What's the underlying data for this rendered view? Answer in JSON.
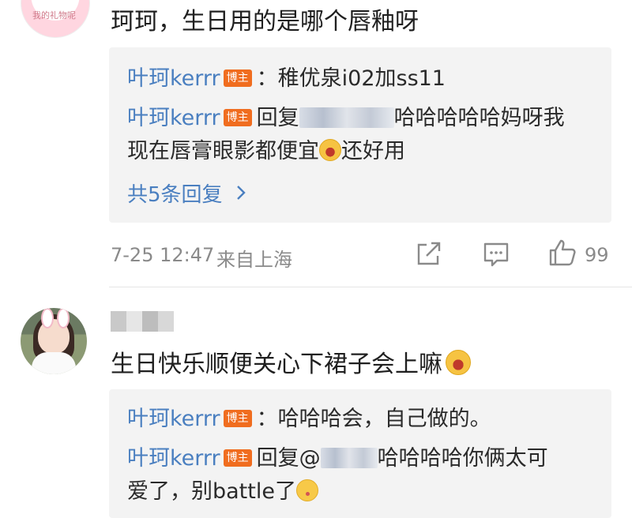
{
  "comment1": {
    "text": "珂珂，生日用的是哪个唇釉呀",
    "avatar_caption": "我的礼物呢",
    "replies": [
      {
        "user": "叶珂kerrr",
        "badge": "博主",
        "text": "：稚优泉i02加ss11"
      },
      {
        "user": "叶珂kerrr",
        "badge": "博主",
        "prefix": "回复",
        "text_a": "哈哈哈哈哈妈呀我",
        "text_b": "现在唇膏眼影都便宜",
        "text_c": "还好用"
      }
    ],
    "more_label": "共5条回复",
    "time": "7-25 12:47",
    "location": "来自上海",
    "like_count": "99"
  },
  "comment2": {
    "text": "生日快乐顺便关心下裙子会上嘛",
    "replies": [
      {
        "user": "叶珂kerrr",
        "badge": "博主",
        "text": "：哈哈哈会，自己做的。"
      },
      {
        "user": "叶珂kerrr",
        "badge": "博主",
        "prefix": "回复@",
        "text_a": "哈哈哈哈你俩太可",
        "text_b": "爱了，别battle了"
      }
    ]
  },
  "icons": [
    "share-icon",
    "comment-icon",
    "like-icon",
    "chevron-right-icon",
    "laugh-emoji-icon",
    "grin-emoji-icon",
    "kiss-emoji-icon"
  ],
  "colors": {
    "username": "#4a7fc0",
    "badge": "#f06d1f",
    "reply_bg": "#f3f3f3",
    "meta": "#8a8a8a"
  }
}
